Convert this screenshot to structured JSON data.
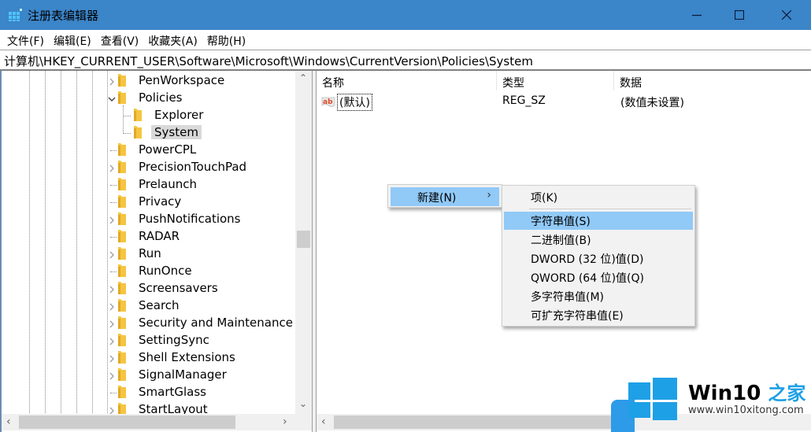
{
  "window": {
    "title": "注册表编辑器",
    "controls": {
      "minimize": "minimize",
      "maximize": "maximize",
      "close": "close"
    }
  },
  "menu": [
    "文件(F)",
    "编辑(E)",
    "查看(V)",
    "收藏夹(A)",
    "帮助(H)"
  ],
  "address": "计算机\\HKEY_CURRENT_USER\\Software\\Microsoft\\Windows\\CurrentVersion\\Policies\\System",
  "tree": {
    "items": [
      {
        "label": "PenWorkspace",
        "level": 0,
        "expander": "collapsed"
      },
      {
        "label": "Policies",
        "level": 0,
        "expander": "expanded"
      },
      {
        "label": "Explorer",
        "level": 1,
        "expander": "none"
      },
      {
        "label": "System",
        "level": 1,
        "expander": "none",
        "selected": true
      },
      {
        "label": "PowerCPL",
        "level": 0,
        "expander": "none"
      },
      {
        "label": "PrecisionTouchPad",
        "level": 0,
        "expander": "collapsed"
      },
      {
        "label": "Prelaunch",
        "level": 0,
        "expander": "none"
      },
      {
        "label": "Privacy",
        "level": 0,
        "expander": "none"
      },
      {
        "label": "PushNotifications",
        "level": 0,
        "expander": "collapsed"
      },
      {
        "label": "RADAR",
        "level": 0,
        "expander": "none"
      },
      {
        "label": "Run",
        "level": 0,
        "expander": "collapsed"
      },
      {
        "label": "RunOnce",
        "level": 0,
        "expander": "none"
      },
      {
        "label": "Screensavers",
        "level": 0,
        "expander": "collapsed"
      },
      {
        "label": "Search",
        "level": 0,
        "expander": "collapsed"
      },
      {
        "label": "Security and Maintenance",
        "level": 0,
        "expander": "collapsed"
      },
      {
        "label": "SettingSync",
        "level": 0,
        "expander": "collapsed"
      },
      {
        "label": "Shell Extensions",
        "level": 0,
        "expander": "collapsed"
      },
      {
        "label": "SignalManager",
        "level": 0,
        "expander": "collapsed"
      },
      {
        "label": "SmartGlass",
        "level": 0,
        "expander": "none"
      },
      {
        "label": "StartLayout",
        "level": 0,
        "expander": "collapsed"
      }
    ]
  },
  "list": {
    "columns": [
      "名称",
      "类型",
      "数据"
    ],
    "rows": [
      {
        "icon": "string-value-icon",
        "name": "(默认)",
        "type": "REG_SZ",
        "data": "(数值未设置)"
      }
    ]
  },
  "context_menu": {
    "new_label": "新建(N)",
    "submenu": [
      {
        "label": "项(K)"
      },
      {
        "label": "字符串值(S)",
        "highlighted": true
      },
      {
        "label": "二进制值(B)"
      },
      {
        "label": "DWORD (32 位)值(D)"
      },
      {
        "label": "QWORD (64 位)值(Q)"
      },
      {
        "label": "多字符串值(M)"
      },
      {
        "label": "可扩充字符串值(E)"
      }
    ]
  },
  "watermark": {
    "brand": "Win10",
    "brand_cn": "之家",
    "url": "www.win10xitong.com"
  },
  "colors": {
    "titlebar": "#3b85c9",
    "menu_highlight": "#91c9f7",
    "selection": "#d9d9d9",
    "folder": "#f5c542",
    "accent": "#1ea0e6"
  }
}
